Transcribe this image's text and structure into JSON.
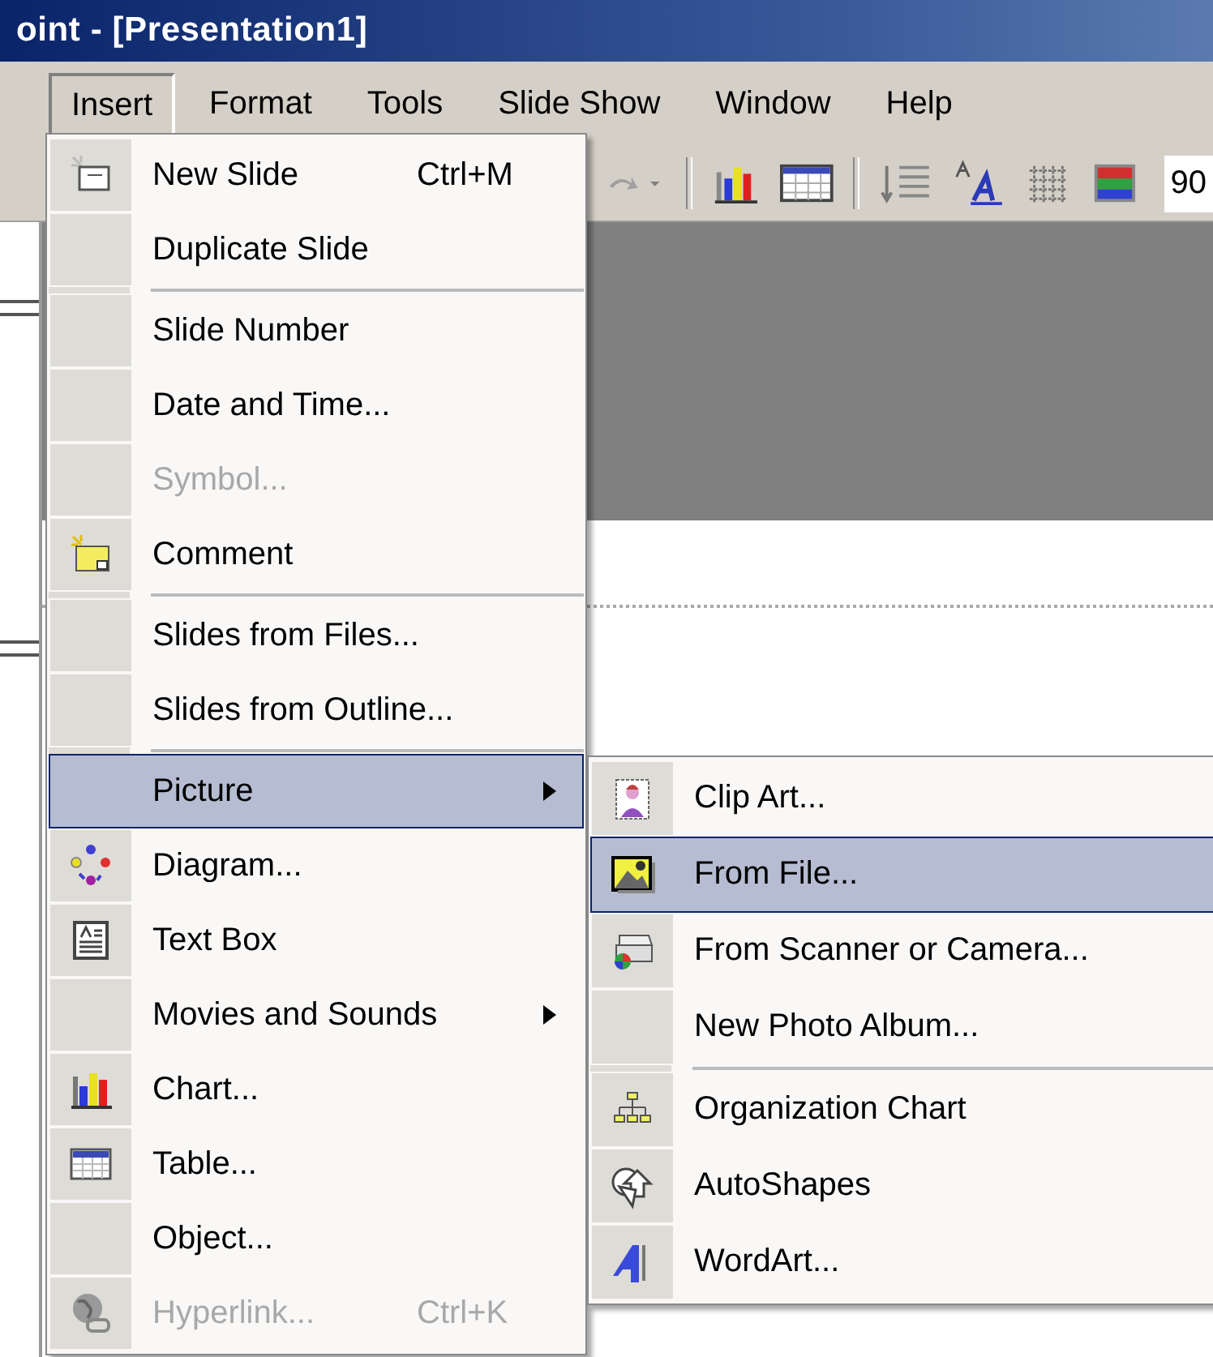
{
  "window": {
    "title": "oint - [Presentation1]"
  },
  "menu_bar": [
    {
      "label": "Insert",
      "selected": true
    },
    {
      "label": "Format",
      "selected": false
    },
    {
      "label": "Tools",
      "selected": false
    },
    {
      "label": "Slide Show",
      "selected": false
    },
    {
      "label": "Window",
      "selected": false
    },
    {
      "label": "Help",
      "selected": false
    }
  ],
  "toolbar": {
    "zoom": "90"
  },
  "insert_menu": {
    "items": [
      {
        "kind": "item",
        "label": "New Slide",
        "shortcut": "Ctrl+M",
        "disabled": false,
        "selected": false,
        "submenu": false
      },
      {
        "kind": "item",
        "label": "Duplicate Slide",
        "disabled": false,
        "selected": false,
        "submenu": false
      },
      {
        "kind": "separator"
      },
      {
        "kind": "item",
        "label": "Slide Number",
        "disabled": false,
        "selected": false,
        "submenu": false
      },
      {
        "kind": "item",
        "label": "Date and Time...",
        "disabled": false,
        "selected": false,
        "submenu": false
      },
      {
        "kind": "item",
        "label": "Symbol...",
        "disabled": true,
        "selected": false,
        "submenu": false
      },
      {
        "kind": "item",
        "label": "Comment",
        "disabled": false,
        "selected": false,
        "submenu": false
      },
      {
        "kind": "separator"
      },
      {
        "kind": "item",
        "label": "Slides from Files...",
        "disabled": false,
        "selected": false,
        "submenu": false
      },
      {
        "kind": "item",
        "label": "Slides from Outline...",
        "disabled": false,
        "selected": false,
        "submenu": false
      },
      {
        "kind": "separator"
      },
      {
        "kind": "item",
        "label": "Picture",
        "disabled": false,
        "selected": true,
        "submenu": true
      },
      {
        "kind": "item",
        "label": "Diagram...",
        "disabled": false,
        "selected": false,
        "submenu": false
      },
      {
        "kind": "item",
        "label": "Text Box",
        "disabled": false,
        "selected": false,
        "submenu": false
      },
      {
        "kind": "item",
        "label": "Movies and Sounds",
        "disabled": false,
        "selected": false,
        "submenu": true
      },
      {
        "kind": "item",
        "label": "Chart...",
        "disabled": false,
        "selected": false,
        "submenu": false
      },
      {
        "kind": "item",
        "label": "Table...",
        "disabled": false,
        "selected": false,
        "submenu": false
      },
      {
        "kind": "item",
        "label": "Object...",
        "disabled": false,
        "selected": false,
        "submenu": false
      },
      {
        "kind": "item",
        "label": "Hyperlink...",
        "shortcut": "Ctrl+K",
        "disabled": true,
        "selected": false,
        "submenu": false
      }
    ]
  },
  "picture_submenu": {
    "items": [
      {
        "kind": "item",
        "label": "Clip Art...",
        "disabled": false,
        "selected": false,
        "submenu": false
      },
      {
        "kind": "item",
        "label": "From File...",
        "disabled": false,
        "selected": true,
        "submenu": false
      },
      {
        "kind": "item",
        "label": "From Scanner or Camera...",
        "disabled": false,
        "selected": false,
        "submenu": false
      },
      {
        "kind": "item",
        "label": "New Photo Album...",
        "disabled": false,
        "selected": false,
        "submenu": false
      },
      {
        "kind": "separator"
      },
      {
        "kind": "item",
        "label": "Organization Chart",
        "disabled": false,
        "selected": false,
        "submenu": false
      },
      {
        "kind": "item",
        "label": "AutoShapes",
        "disabled": false,
        "selected": false,
        "submenu": false
      },
      {
        "kind": "item",
        "label": "WordArt...",
        "disabled": false,
        "selected": false,
        "submenu": false
      }
    ]
  }
}
